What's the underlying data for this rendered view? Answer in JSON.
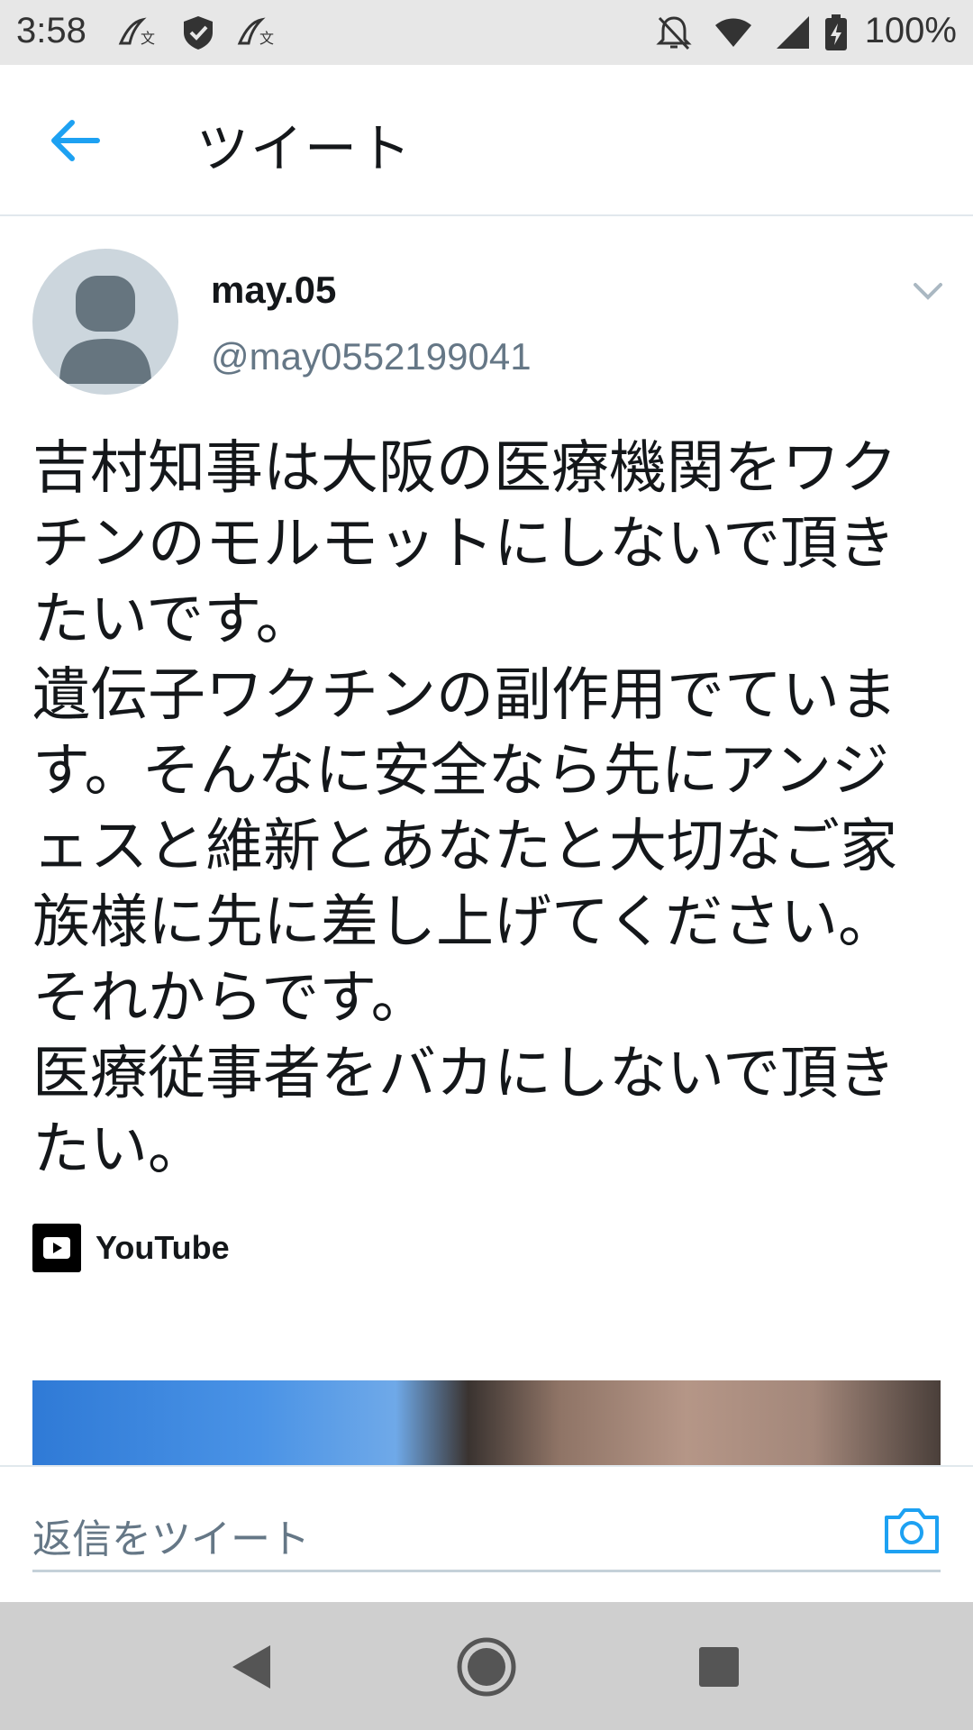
{
  "status_bar": {
    "time": "3:58",
    "battery": "100%",
    "icons": [
      "app-notification-icon",
      "shield-icon",
      "app-notification-icon",
      "notifications-off-icon",
      "wifi-icon",
      "cell-signal-icon",
      "battery-charging-icon"
    ]
  },
  "header": {
    "back_icon": "arrow-left-icon",
    "title": "ツイート"
  },
  "tweet": {
    "user_name": "may.05",
    "user_handle": "@may0552199041",
    "menu_icon": "chevron-down-icon",
    "text": "吉村知事は大阪の医療機関をワク\nチンのモルモットにしないで頂き\nたいです。\n遺伝子ワクチンの副作用でていま\nす。そんなに安全なら先にアンジ\nェスと維新とあなたと大切なご家\n族様に先に差し上げてください。\nそれからです。\n医療従事者をバカにしないで頂き\nたい。",
    "card": {
      "source_label": "YouTube",
      "source_icon": "youtube-icon"
    }
  },
  "reply": {
    "placeholder": "返信をツイート",
    "camera_icon": "camera-icon"
  },
  "navigation": {
    "back": "nav-back-icon",
    "home": "nav-home-icon",
    "recents": "nav-recents-icon"
  },
  "colors": {
    "accent": "#1da1f2",
    "status_bar_bg": "#e7e7e7",
    "nav_bar_bg": "#cfcfcf",
    "secondary_text": "#657786"
  }
}
